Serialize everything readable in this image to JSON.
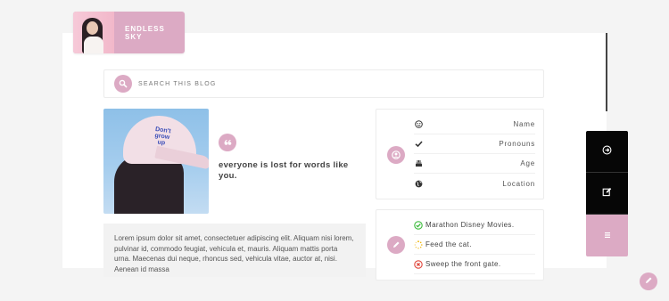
{
  "header": {
    "title": "ENDLESS SKY",
    "avatar_icon": "user-photo"
  },
  "search": {
    "placeholder": "SEARCH THIS BLOG",
    "icon": "search-icon"
  },
  "photo": {
    "cap_text": [
      "Don't",
      "grow",
      "up"
    ]
  },
  "quote": {
    "icon": "quote-icon",
    "text": "everyone is lost for words like you."
  },
  "body_text": "Lorem ipsum dolor sit amet, consectetuer adipiscing elit. Aliquam nisi lorem, pulvinar id, commodo feugiat, vehicula et, mauris. Aliquam mattis porta urna. Maecenas dui neque, rhoncus sed, vehicula vitae, auctor at, nisi. Aenean id massa",
  "profile": {
    "icon": "user-circle-icon",
    "rows": [
      {
        "icon": "smile-icon",
        "label": "Name"
      },
      {
        "icon": "check-icon",
        "label": "Pronouns"
      },
      {
        "icon": "cake-icon",
        "label": "Age"
      },
      {
        "icon": "globe-icon",
        "label": "Location"
      }
    ]
  },
  "todos": {
    "icon": "pencil-icon",
    "items": [
      {
        "status": "done",
        "label": "Marathon Disney Movies."
      },
      {
        "status": "in-progress",
        "label": "Feed the cat."
      },
      {
        "status": "not-done",
        "label": "Sweep the front gate."
      }
    ]
  },
  "side_nav": [
    {
      "icon": "arrow-circle-icon"
    },
    {
      "icon": "edit-icon"
    },
    {
      "icon": "menu-icon"
    }
  ],
  "colors": {
    "accent": "#dcaac4",
    "dark": "#060606",
    "done": "#3dbb3d",
    "in_progress": "#f0b400",
    "not_done": "#e0453a"
  }
}
